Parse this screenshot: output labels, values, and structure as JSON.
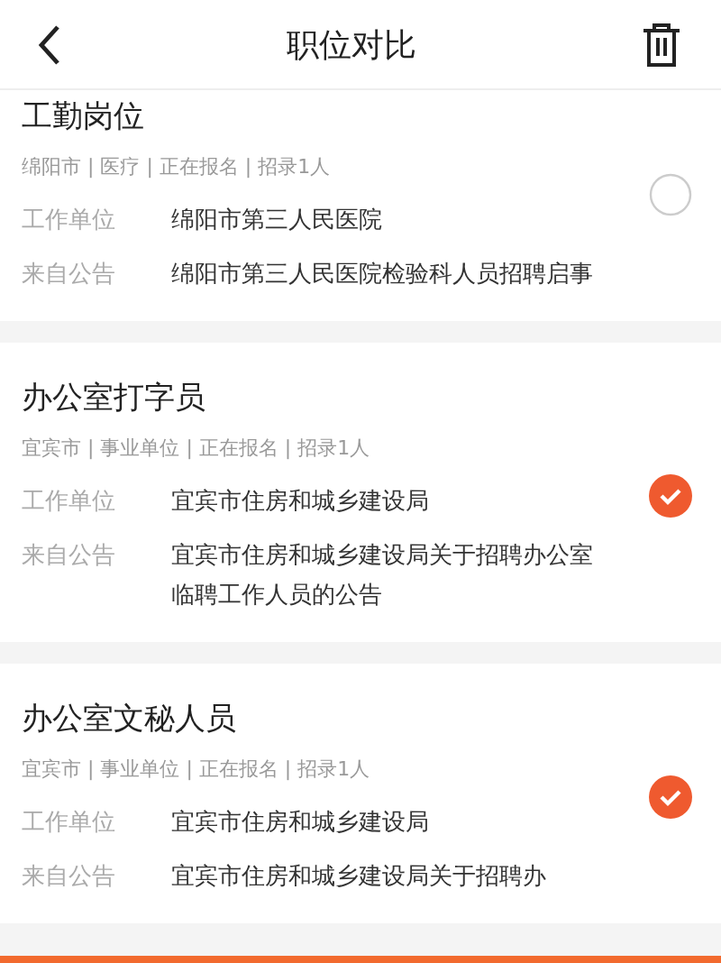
{
  "header": {
    "title": "职位对比"
  },
  "jobs": [
    {
      "title": "工勤岗位",
      "meta": "绵阳市 | 医疗 | 正在报名 | 招录1人",
      "unit_label": "工作单位",
      "unit": "绵阳市第三人民医院",
      "notice_label": "来自公告",
      "notice": "绵阳市第三人民医院检验科人员招聘启事",
      "selected": false
    },
    {
      "title": "办公室打字员",
      "meta": "宜宾市 | 事业单位 | 正在报名 | 招录1人",
      "unit_label": "工作单位",
      "unit": "宜宾市住房和城乡建设局",
      "notice_label": "来自公告",
      "notice": "宜宾市住房和城乡建设局关于招聘办公室临聘工作人员的公告",
      "selected": true
    },
    {
      "title": "办公室文秘人员",
      "meta": "宜宾市 | 事业单位 | 正在报名 | 招录1人",
      "unit_label": "工作单位",
      "unit": "宜宾市住房和城乡建设局",
      "notice_label": "来自公告",
      "notice": "宜宾市住房和城乡建设局关于招聘办",
      "selected": true
    }
  ]
}
